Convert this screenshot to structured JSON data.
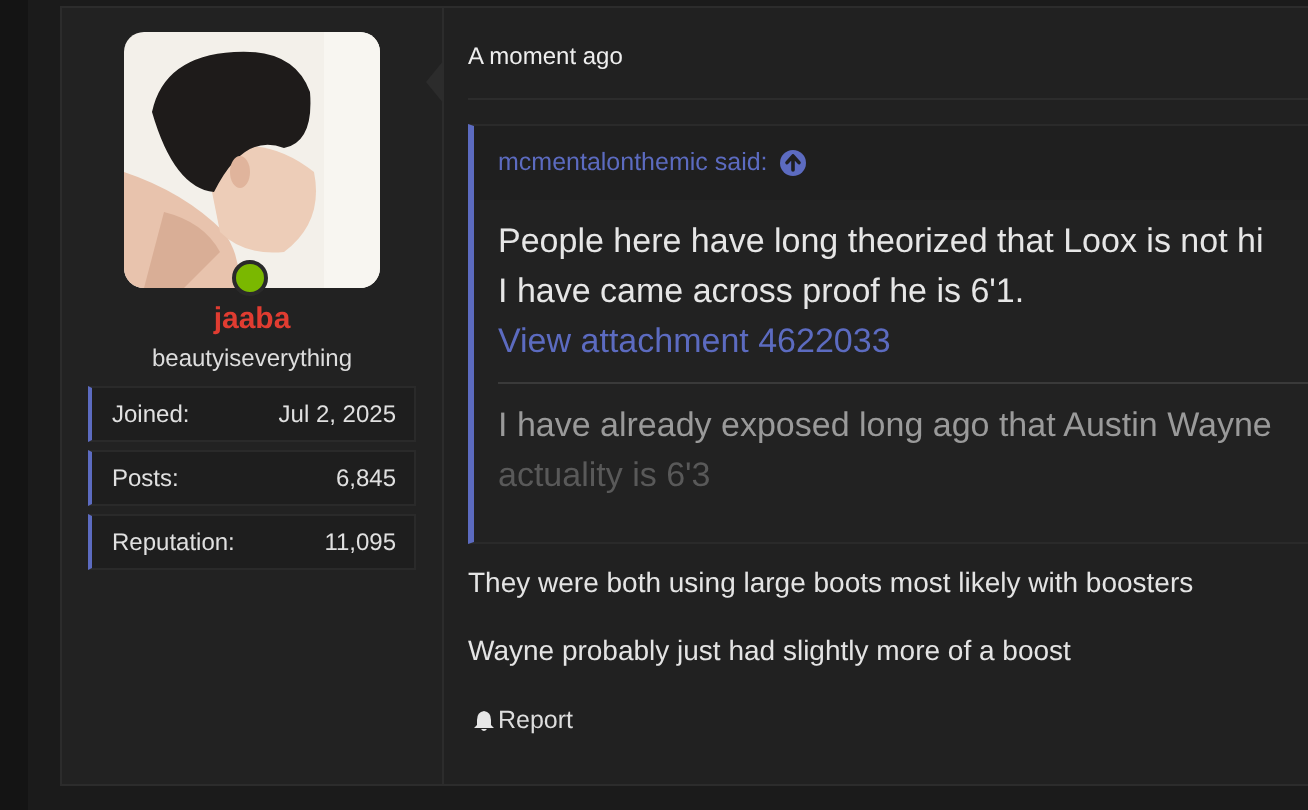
{
  "user": {
    "name": "jaaba",
    "title": "beautyiseverything",
    "online": true,
    "stats": [
      {
        "label": "Joined:",
        "value": "Jul 2, 2025"
      },
      {
        "label": "Posts:",
        "value": "6,845"
      },
      {
        "label": "Reputation:",
        "value": "11,095"
      }
    ]
  },
  "post": {
    "time": "A moment ago",
    "quote": {
      "author": "mcmentalonthemic said:",
      "lines": [
        "People here have long theorized that Loox is not hi",
        "I have came across proof he is 6'1."
      ],
      "attachment": "View attachment 4622033",
      "more": [
        "I have already exposed long ago that Austin Wayne",
        "actuality is 6'3"
      ]
    },
    "body": [
      "They were both using large boots most likely with boosters",
      "Wayne probably just had slightly more of a boost"
    ],
    "actions": [
      "Report"
    ]
  }
}
